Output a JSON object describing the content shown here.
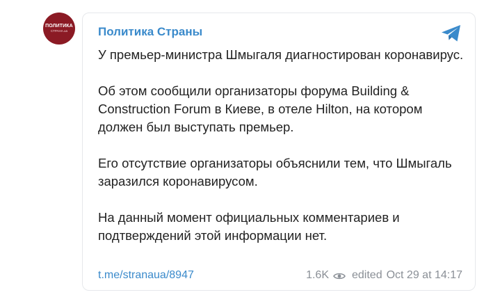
{
  "channel": {
    "avatar_line1": "ПОЛИТИКА",
    "avatar_line2": "СТРАНА.ua",
    "name": "Политика Страны"
  },
  "post": {
    "paragraphs": [
      "У премьер-министра Шмыгаля диагностирован коронавирус.",
      "Об этом сообщили организаторы форума Building & Construction Forum в Киеве, в отеле Hilton, на котором должен был выступать премьер.",
      "Его отсутствие организаторы объяснили тем, что Шмыгаль заразился коронавирусом.",
      "На данный момент официальных комментариев и подтверждений этой информации нет."
    ],
    "link_text": "t.me/stranaua/8947",
    "views": "1.6K",
    "edited_label": "edited",
    "timestamp": "Oct 29 at 14:17"
  },
  "colors": {
    "accent": "#3a8acb",
    "avatar_bg": "#8b1a24",
    "meta_text": "#8a8f96",
    "body_text": "#222222"
  },
  "icons": {
    "telegram": "telegram-plane-icon",
    "views": "eye-icon"
  }
}
